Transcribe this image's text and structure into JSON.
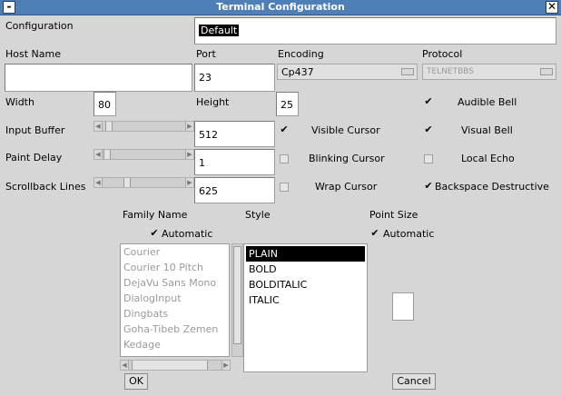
{
  "window": {
    "title": "Terminal Configuration"
  },
  "labels": {
    "configuration": "Configuration",
    "host_name": "Host Name",
    "port": "Port",
    "encoding": "Encoding",
    "protocol": "Protocol",
    "width": "Width",
    "height": "Height",
    "input_buffer": "Input Buffer",
    "paint_delay": "Paint Delay",
    "scrollback_lines": "Scrollback Lines",
    "family_name": "Family Name",
    "style": "Style",
    "point_size": "Point Size"
  },
  "fields": {
    "configuration": "Default",
    "host_name": "",
    "port": "23",
    "width": "80",
    "height": "25",
    "input_buffer": "512",
    "paint_delay": "1",
    "scrollback_lines": "625",
    "point_size": ""
  },
  "combos": {
    "encoding": "Cp437",
    "protocol": "TELNETBBS"
  },
  "checkboxes": {
    "audible_bell": {
      "label": "Audible Bell",
      "checked": true
    },
    "visible_cursor": {
      "label": "Visible Cursor",
      "checked": true
    },
    "visual_bell": {
      "label": "Visual Bell",
      "checked": true
    },
    "blinking_cursor": {
      "label": "Blinking Cursor",
      "checked": false
    },
    "local_echo": {
      "label": "Local Echo",
      "checked": false
    },
    "wrap_cursor": {
      "label": "Wrap Cursor",
      "checked": false
    },
    "backspace_destructive": {
      "label": "Backspace Destructive",
      "checked": true
    },
    "family_automatic": {
      "label": "Automatic",
      "checked": true
    },
    "point_automatic": {
      "label": "Automatic",
      "checked": true
    }
  },
  "sliders": {
    "input_buffer": 0.05,
    "paint_delay": 0.0,
    "scrollback_lines": 0.25
  },
  "family_list": [
    "Courier",
    "Courier 10 Pitch",
    "DejaVu Sans Mono",
    "DialogInput",
    "Dingbats",
    "Goha-Tibeb Zemen",
    "Kedage"
  ],
  "style_list": [
    "PLAIN",
    "BOLD",
    "BOLDITALIC",
    "ITALIC"
  ],
  "style_selected": "PLAIN",
  "buttons": {
    "ok": "OK",
    "cancel": "Cancel"
  },
  "glyphs": {
    "check": "✔",
    "window_menu": "-",
    "close": "✕"
  }
}
